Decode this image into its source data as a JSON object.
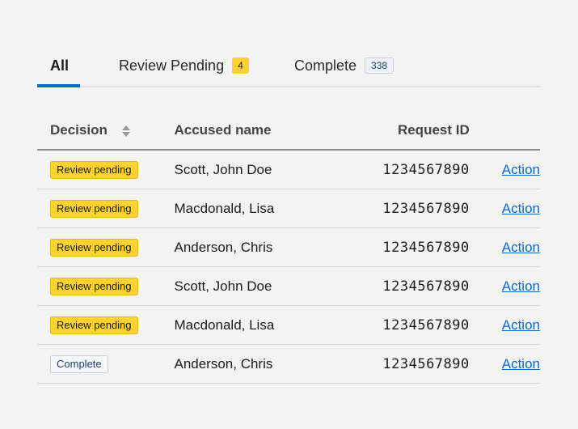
{
  "tabs": [
    {
      "label": "All",
      "active": true
    },
    {
      "label": "Review Pending",
      "count": "4",
      "count_color": "#fcd232"
    },
    {
      "label": "Complete",
      "count": "338"
    }
  ],
  "accent_color": "#0b6bc8",
  "table": {
    "headers": {
      "decision": "Decision",
      "name": "Accused name",
      "request_id": "Request ID"
    },
    "sort_icon": "sort-icon",
    "rows": [
      {
        "decision": "Review pending",
        "status": "pending",
        "name": "Scott, John Doe",
        "request_id": "1234567890",
        "action": "Action"
      },
      {
        "decision": "Review pending",
        "status": "pending",
        "name": "Macdonald, Lisa",
        "request_id": "1234567890",
        "action": "Action"
      },
      {
        "decision": "Review pending",
        "status": "pending",
        "name": "Anderson, Chris",
        "request_id": "1234567890",
        "action": "Action"
      },
      {
        "decision": "Review pending",
        "status": "pending",
        "name": "Scott, John Doe",
        "request_id": "1234567890",
        "action": "Action"
      },
      {
        "decision": "Review pending",
        "status": "pending",
        "name": "Macdonald, Lisa",
        "request_id": "1234567890",
        "action": "Action"
      },
      {
        "decision": "Complete",
        "status": "complete",
        "name": "Anderson, Chris",
        "request_id": "1234567890",
        "action": "Action"
      }
    ]
  }
}
